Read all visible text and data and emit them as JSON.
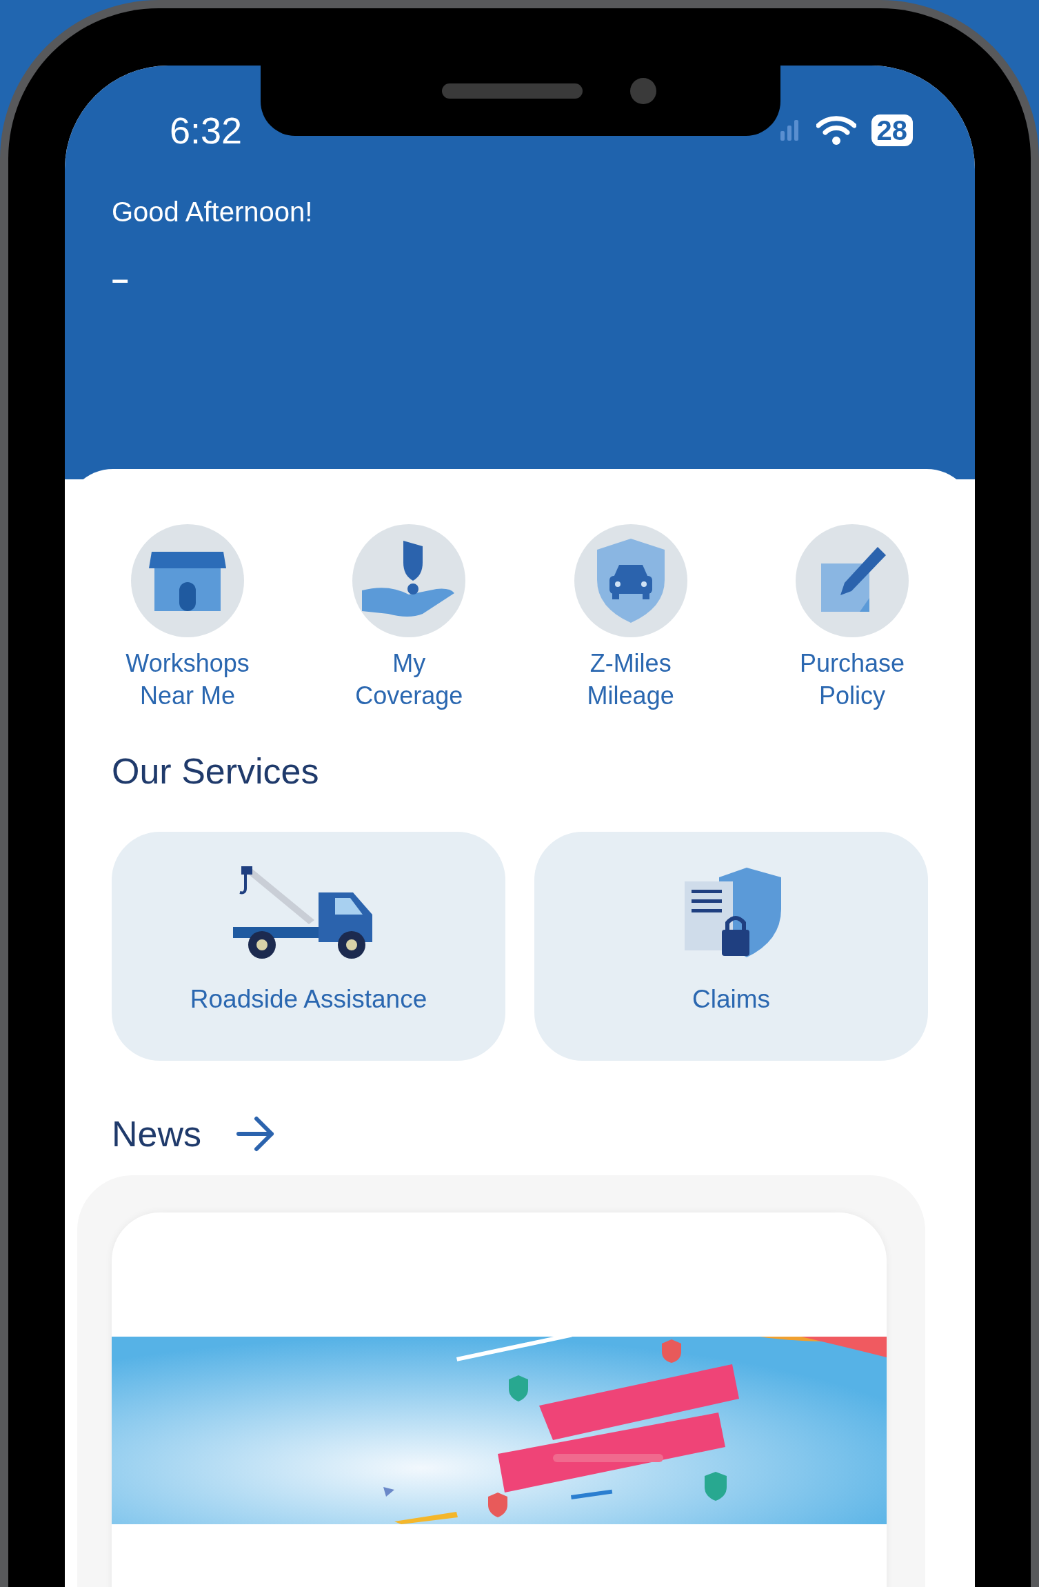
{
  "status_bar": {
    "time": "6:32",
    "battery": "28"
  },
  "greeting": "Good Afternoon!",
  "user_name": "–",
  "quick_actions": [
    {
      "label": "Workshops\nNear Me",
      "kind": "shop"
    },
    {
      "label": "My\nCoverage",
      "kind": "hand-shield"
    },
    {
      "label": "Z-Miles\nMileage",
      "kind": "car-shield"
    },
    {
      "label": "Purchase\nPolicy",
      "kind": "pen-note"
    }
  ],
  "services_title": "Our Services",
  "services": [
    {
      "label": "Roadside Assistance",
      "kind": "tow-truck"
    },
    {
      "label": "Claims",
      "kind": "document-shield"
    }
  ],
  "news_title": "News"
}
